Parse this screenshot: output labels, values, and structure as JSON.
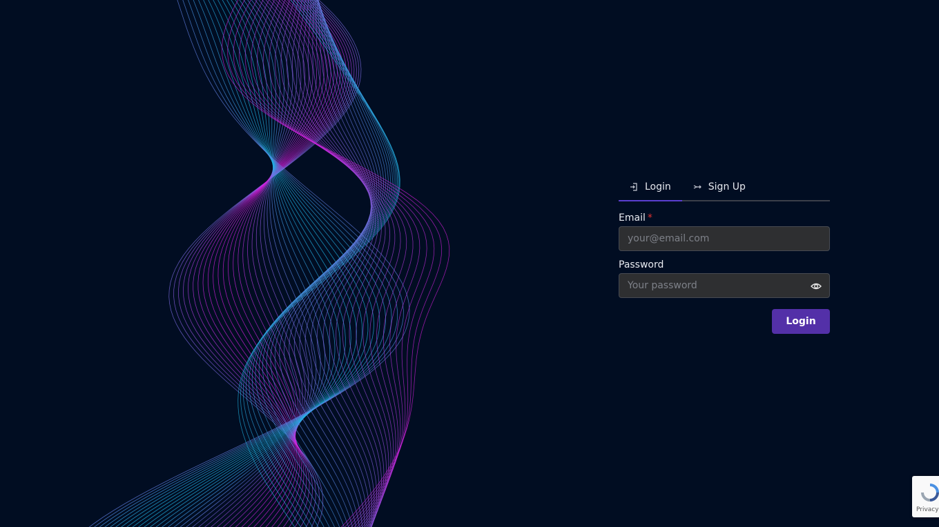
{
  "tabs": [
    {
      "label": "Login",
      "icon": "login-icon",
      "active": true
    },
    {
      "label": "Sign Up",
      "icon": "signup-icon",
      "active": false
    }
  ],
  "form": {
    "email_label": "Email",
    "email_required_mark": "*",
    "email_placeholder": "your@email.com",
    "email_value": "",
    "password_label": "Password",
    "password_placeholder": "Your password",
    "password_value": "",
    "submit_label": "Login"
  },
  "recaptcha": {
    "terms": "Privacy - Terms"
  },
  "colors": {
    "background": "#010d22",
    "accent": "#5330a8",
    "wave_cyan": "#1fb6e6",
    "wave_magenta": "#d81fe0"
  }
}
